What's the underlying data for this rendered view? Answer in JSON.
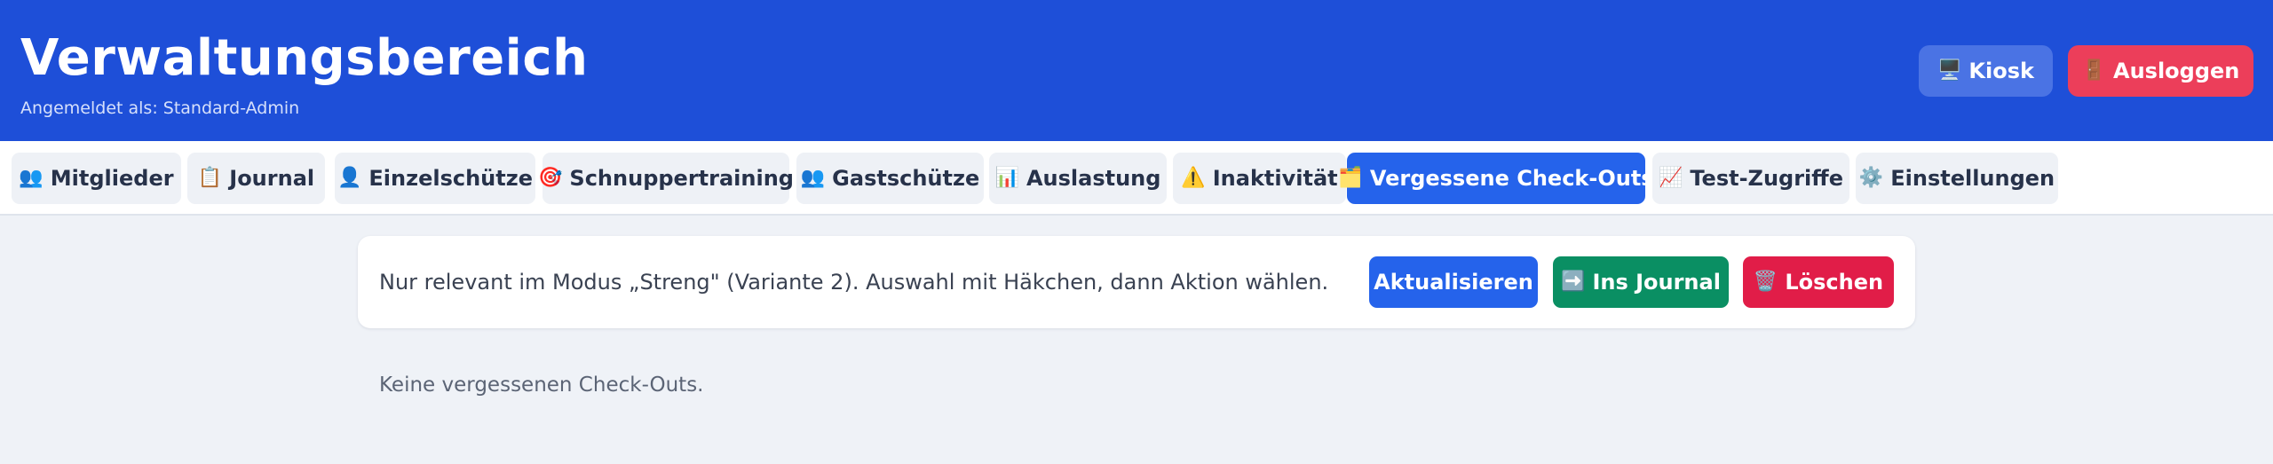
{
  "header": {
    "title": "Verwaltungsbereich",
    "subtitle": "Angemeldet als: Standard-Admin",
    "kiosk": {
      "icon": "🖥️",
      "label": "Kiosk"
    },
    "logout": {
      "icon": "🚪",
      "label": "Ausloggen"
    }
  },
  "nav": {
    "active": "Vergessene Check-Outs",
    "tabs": [
      {
        "icon": "👥",
        "label": "Mitglieder"
      },
      {
        "icon": "📋",
        "label": "Journal"
      },
      {
        "icon": "👤",
        "label": "Einzelschütze"
      },
      {
        "icon": "🎯",
        "label": "Schnuppertraining"
      },
      {
        "icon": "👥",
        "label": "Gastschütze"
      },
      {
        "icon": "📊",
        "label": "Auslastung"
      },
      {
        "icon": "⚠️",
        "label": "Inaktivität"
      },
      {
        "icon": "🗂️",
        "label": "Vergessene Check-Outs"
      },
      {
        "icon": "📈",
        "label": "Test-Zugriffe"
      },
      {
        "icon": "⚙️",
        "label": "Einstellungen"
      }
    ]
  },
  "panel": {
    "info": "Nur relevant im Modus „Streng\" (Variante 2). Auswahl mit Häkchen, dann Aktion wählen.",
    "refresh_label": "Aktualisieren",
    "journal": {
      "icon": "➡️",
      "label": "Ins Journal"
    },
    "delete": {
      "icon": "🗑️",
      "label": "Löschen"
    }
  },
  "empty_message": "Keine vergessenen Check-Outs.",
  "colors": {
    "header_bg": "#1e4fd8",
    "primary": "#2563eb",
    "success": "#0a8f63",
    "danger": "#e11d48",
    "logout": "#ec3e5a"
  }
}
